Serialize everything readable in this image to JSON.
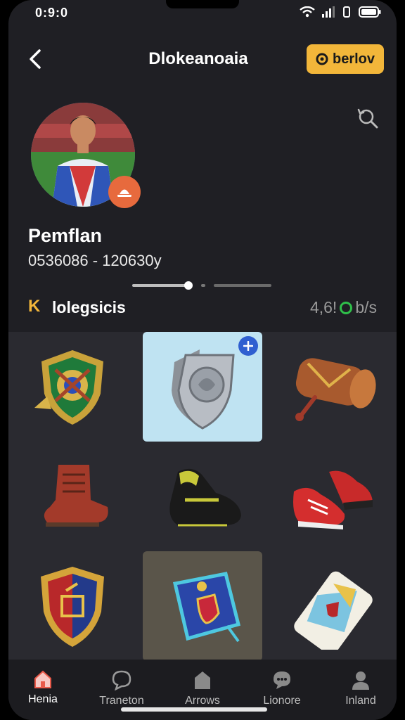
{
  "status": {
    "time": "0:9:0"
  },
  "header": {
    "title": "Dlokeanoaia",
    "action_label": "berlov"
  },
  "profile": {
    "name": "Pemflan",
    "meta": "0536086 - 120630y"
  },
  "section": {
    "letter": "K",
    "label": "lolegsicis",
    "stat": "4,6!",
    "stat_suffix": "b/s"
  },
  "items": [
    {
      "name": "emerald-crest-shield",
      "selected": false
    },
    {
      "name": "silver-shield",
      "selected": true
    },
    {
      "name": "wooden-barrel-drum",
      "selected": false
    },
    {
      "name": "red-leather-boot",
      "selected": false
    },
    {
      "name": "black-yellow-shoe",
      "selected": false
    },
    {
      "name": "red-black-sneakers",
      "selected": false
    },
    {
      "name": "red-blue-crest-shield",
      "selected": false
    },
    {
      "name": "blue-banner",
      "selected": false,
      "highlight": true
    },
    {
      "name": "phone-card",
      "selected": false
    }
  ],
  "nav": [
    {
      "label": "Henia",
      "icon": "home-icon",
      "active": true
    },
    {
      "label": "Traneton",
      "icon": "chat-icon",
      "active": false
    },
    {
      "label": "Arrows",
      "icon": "shop-icon",
      "active": false
    },
    {
      "label": "Lionore",
      "icon": "message-icon",
      "active": false
    },
    {
      "label": "Inland",
      "icon": "profile-icon",
      "active": false
    }
  ],
  "colors": {
    "accent": "#f2b63a",
    "background": "#1f1f24",
    "badge": "#e76a3d",
    "selected_cell": "#bfe3f2"
  }
}
